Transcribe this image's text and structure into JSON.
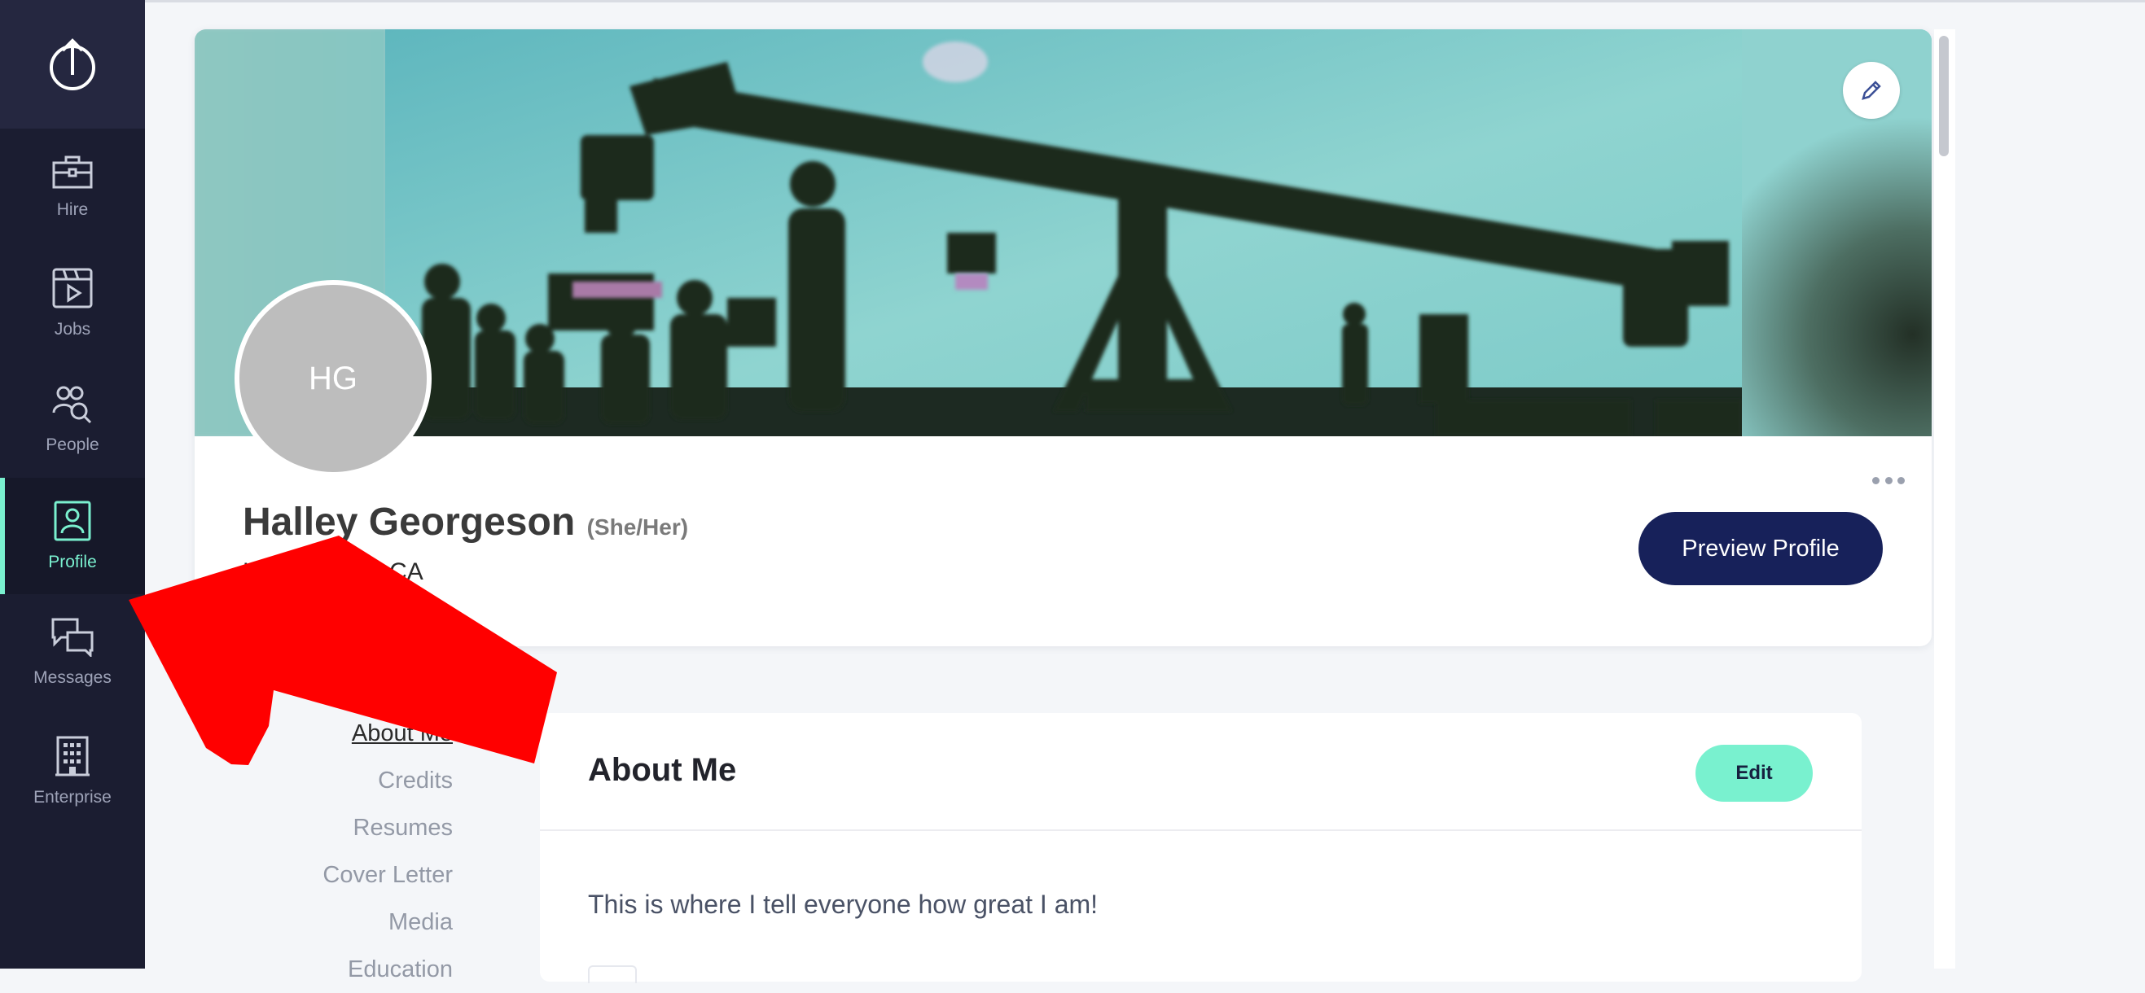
{
  "sidebar": {
    "items": [
      {
        "label": "Hire",
        "icon": "briefcase-icon"
      },
      {
        "label": "Jobs",
        "icon": "clapperboard-icon"
      },
      {
        "label": "People",
        "icon": "people-search-icon"
      },
      {
        "label": "Profile",
        "icon": "profile-card-icon"
      },
      {
        "label": "Messages",
        "icon": "chat-bubbles-icon"
      },
      {
        "label": "Enterprise",
        "icon": "building-icon"
      }
    ],
    "active": "Profile",
    "accent_color": "#7af0cf"
  },
  "profile": {
    "initials": "HG",
    "name": "Halley Georgeson",
    "pronouns": "(She/Her)",
    "location": "Los Angeles, CA",
    "preview_button": "Preview Profile"
  },
  "section_nav": {
    "items": [
      "About Me",
      "Credits",
      "Resumes",
      "Cover Letter",
      "Media",
      "Education"
    ],
    "active": "About Me"
  },
  "about": {
    "title": "About Me",
    "edit_label": "Edit",
    "text": "This is where I tell everyone how great I am!"
  },
  "colors": {
    "sidebar_bg": "#1b1d31",
    "primary_button": "#17215a",
    "annotation_arrow": "#ff0000"
  }
}
